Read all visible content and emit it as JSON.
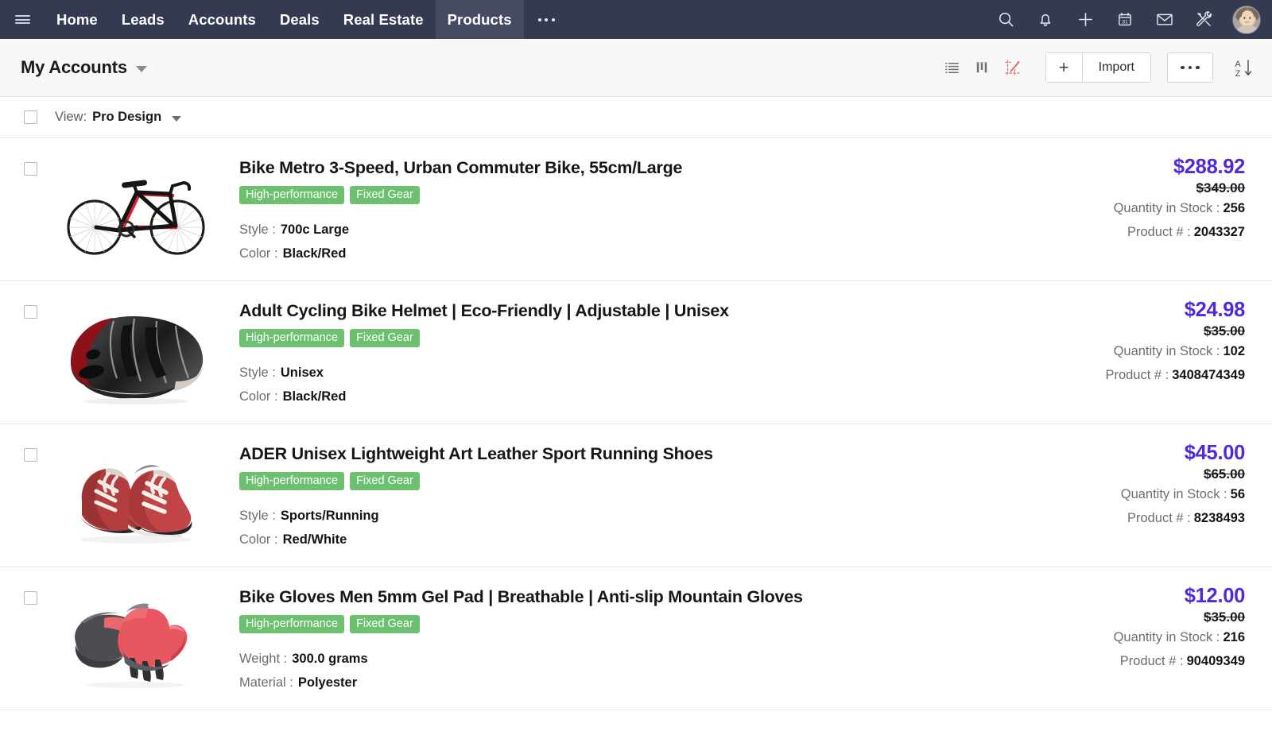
{
  "topnav": {
    "menu_icon": "hamburger-icon",
    "items": [
      {
        "label": "Home",
        "active": false
      },
      {
        "label": "Leads",
        "active": false
      },
      {
        "label": "Accounts",
        "active": false
      },
      {
        "label": "Deals",
        "active": false
      },
      {
        "label": "Real Estate",
        "active": false
      },
      {
        "label": "Products",
        "active": true
      }
    ],
    "overflow_label": "...",
    "icons": [
      "search-icon",
      "bell-icon",
      "plus-icon",
      "calendar-icon",
      "mail-icon",
      "tools-icon"
    ],
    "calendar_day": "31",
    "avatar": "user-avatar"
  },
  "toolbar": {
    "module_title": "My Accounts",
    "view_icons": [
      "list-view-icon",
      "kanban-view-icon",
      "canvas-view-icon"
    ],
    "create_label": "+",
    "import_label": "Import",
    "more_label": "...",
    "sort_label_top": "A",
    "sort_label_bottom": "Z"
  },
  "viewbar": {
    "label": "View:",
    "value": "Pro Design"
  },
  "colors": {
    "nav_bg": "#343a52",
    "nav_active": "#454b63",
    "price": "#5128dc",
    "tag_green": "#6cc070",
    "toolbar_bg": "#f7f7f7",
    "canvas_icon_red": "#e0736e"
  },
  "products": [
    {
      "image": "road-bike-image",
      "title": "Bike Metro 3-Speed, Urban Commuter Bike, 55cm/Large",
      "tags": [
        "High-performance",
        "Fixed Gear"
      ],
      "attr1_key": "Style :",
      "attr1_value": "700c Large",
      "attr2_key": "Color :",
      "attr2_value": "Black/Red",
      "price": "$288.92",
      "old_price": "$349.00",
      "stock_key": "Quantity in Stock :",
      "stock_value": "256",
      "product_key": "Product # :",
      "product_value": "2043327"
    },
    {
      "image": "bike-helmet-image",
      "title": "Adult Cycling Bike Helmet | Eco-Friendly | Adjustable | Unisex",
      "tags": [
        "High-performance",
        "Fixed Gear"
      ],
      "attr1_key": "Style :",
      "attr1_value": "Unisex",
      "attr2_key": "Color :",
      "attr2_value": "Black/Red",
      "price": "$24.98",
      "old_price": "$35.00",
      "stock_key": "Quantity in Stock :",
      "stock_value": "102",
      "product_key": "Product # :",
      "product_value": "3408474349"
    },
    {
      "image": "running-shoes-image",
      "title": "ADER Unisex Lightweight Art Leather Sport Running Shoes",
      "tags": [
        "High-performance",
        "Fixed Gear"
      ],
      "attr1_key": "Style :",
      "attr1_value": "Sports/Running",
      "attr2_key": "Color :",
      "attr2_value": "Red/White",
      "price": "$45.00",
      "old_price": "$65.00",
      "stock_key": "Quantity in Stock :",
      "stock_value": "56",
      "product_key": "Product # :",
      "product_value": "8238493"
    },
    {
      "image": "cycling-gloves-image",
      "title": "Bike Gloves Men 5mm Gel Pad | Breathable | Anti-slip Mountain Gloves",
      "tags": [
        "High-performance",
        "Fixed Gear"
      ],
      "attr1_key": "Weight :",
      "attr1_value": "300.0 grams",
      "attr2_key": "Material :",
      "attr2_value": "Polyester",
      "price": "$12.00",
      "old_price": "$35.00",
      "stock_key": "Quantity in Stock :",
      "stock_value": "216",
      "product_key": "Product # :",
      "product_value": "90409349"
    }
  ]
}
